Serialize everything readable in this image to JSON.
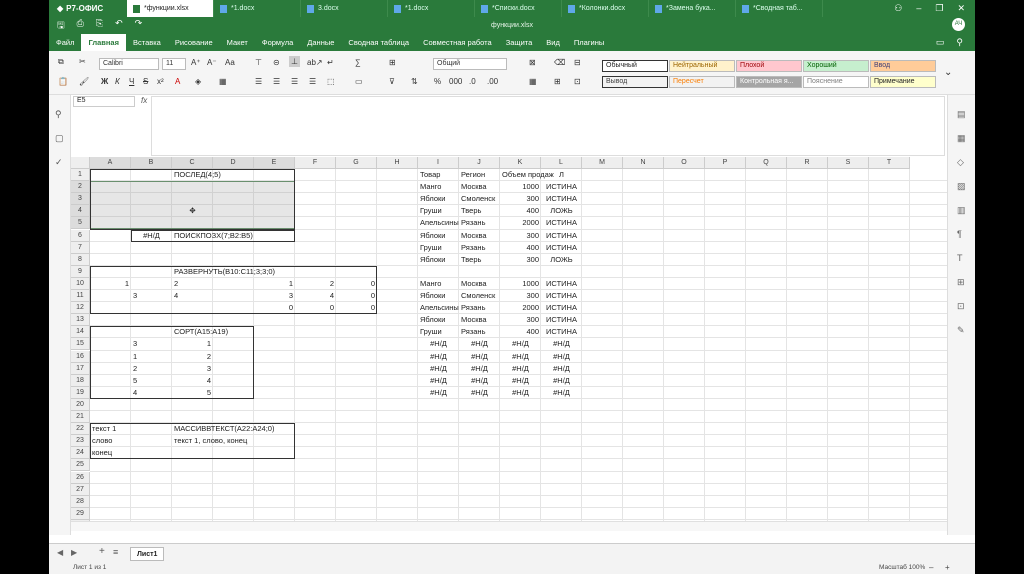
{
  "app": {
    "brand": "Р7-ОФИС",
    "filename": "функции.xlsx"
  },
  "doc_tabs": [
    {
      "label": "*функции.xlsx",
      "active": true
    },
    {
      "label": "*1.docx"
    },
    {
      "label": "3.docx"
    },
    {
      "label": "*1.docx"
    },
    {
      "label": "*Списки.docx"
    },
    {
      "label": "*Колонки.docx"
    },
    {
      "label": "*Замена бука..."
    },
    {
      "label": "*Сводная таб..."
    }
  ],
  "menu": [
    "Файл",
    "Главная",
    "Вставка",
    "Рисование",
    "Макет",
    "Формула",
    "Данные",
    "Сводная таблица",
    "Совместная работа",
    "Защита",
    "Вид",
    "Плагины"
  ],
  "active_menu": "Главная",
  "toolbar": {
    "font_name": "Calibri",
    "font_size": "11",
    "number_format": "Общий",
    "styles": [
      {
        "label": "Обычный",
        "bg": "#ffffff",
        "color": "#222222"
      },
      {
        "label": "Нейтральный",
        "bg": "#fff2cc",
        "color": "#9c6500"
      },
      {
        "label": "Плохой",
        "bg": "#ffc7ce",
        "color": "#9c0006"
      },
      {
        "label": "Хороший",
        "bg": "#c6efce",
        "color": "#006100"
      },
      {
        "label": "Ввод",
        "bg": "#ffcc99",
        "color": "#3f3f76"
      },
      {
        "label": "Вывод",
        "bg": "#f2f2f2",
        "color": "#3f3f3f"
      },
      {
        "label": "Пересчет",
        "bg": "#f2f2f2",
        "color": "#fa7d00"
      },
      {
        "label": "Контрольная я...",
        "bg": "#a5a5a5",
        "color": "#ffffff"
      },
      {
        "label": "Пояснение",
        "bg": "#ffffff",
        "color": "#7f7f7f"
      },
      {
        "label": "Примечание",
        "bg": "#ffffcc",
        "color": "#222222"
      }
    ]
  },
  "namebox": "E5",
  "fx_label": "fx",
  "columns": [
    "A",
    "B",
    "C",
    "D",
    "E",
    "F",
    "G",
    "H",
    "I",
    "J",
    "K",
    "L",
    "M",
    "N",
    "O",
    "P",
    "Q",
    "R",
    "S",
    "T"
  ],
  "rows": [
    "1",
    "2",
    "3",
    "4",
    "5",
    "6",
    "7",
    "8",
    "9",
    "10",
    "11",
    "12",
    "13",
    "14",
    "15",
    "16",
    "17",
    "18",
    "19",
    "20",
    "21",
    "22",
    "23",
    "24",
    "25",
    "26",
    "27",
    "28",
    "29",
    "30"
  ],
  "cells": [
    {
      "ref": "C1",
      "v": "ПОСЛЕД(4;5)"
    },
    {
      "ref": "B6",
      "v": "#Н/Д",
      "align": "c"
    },
    {
      "ref": "C6",
      "v": "ПОИСКПОЗX(7;B2:B5)"
    },
    {
      "ref": "C9",
      "v": "РАЗВЕРНУТЬ(B10:C11;3;3;0)"
    },
    {
      "ref": "A10",
      "v": "1",
      "align": "r"
    },
    {
      "ref": "C10",
      "v": "2"
    },
    {
      "ref": "E10",
      "v": "1",
      "align": "r"
    },
    {
      "ref": "F10",
      "v": "2",
      "align": "r"
    },
    {
      "ref": "G10",
      "v": "0",
      "align": "r"
    },
    {
      "ref": "B11",
      "v": "3"
    },
    {
      "ref": "C11",
      "v": "4"
    },
    {
      "ref": "E11",
      "v": "3",
      "align": "r"
    },
    {
      "ref": "F11",
      "v": "4",
      "align": "r"
    },
    {
      "ref": "G11",
      "v": "0",
      "align": "r"
    },
    {
      "ref": "E12",
      "v": "0",
      "align": "r"
    },
    {
      "ref": "F12",
      "v": "0",
      "align": "r"
    },
    {
      "ref": "G12",
      "v": "0",
      "align": "r"
    },
    {
      "ref": "C14",
      "v": "СОРТ(A15:A19)"
    },
    {
      "ref": "B15",
      "v": "3",
      "align": "l"
    },
    {
      "ref": "C15",
      "v": "1",
      "align": "r"
    },
    {
      "ref": "B16",
      "v": "1",
      "align": "l"
    },
    {
      "ref": "C16",
      "v": "2",
      "align": "r"
    },
    {
      "ref": "B17",
      "v": "2",
      "align": "l"
    },
    {
      "ref": "C17",
      "v": "3",
      "align": "r"
    },
    {
      "ref": "B18",
      "v": "5",
      "align": "l"
    },
    {
      "ref": "C18",
      "v": "4",
      "align": "r"
    },
    {
      "ref": "B19",
      "v": "4",
      "align": "l"
    },
    {
      "ref": "C19",
      "v": "5",
      "align": "r"
    },
    {
      "ref": "A22",
      "v": "текст 1"
    },
    {
      "ref": "C22",
      "v": "МАССИВВТЕКСТ(A22:A24;0)"
    },
    {
      "ref": "A23",
      "v": "слово"
    },
    {
      "ref": "C23",
      "v": "текст 1, слово, конец"
    },
    {
      "ref": "A24",
      "v": "конец"
    },
    {
      "ref": "I1",
      "v": "Товар"
    },
    {
      "ref": "J1",
      "v": "Регион"
    },
    {
      "ref": "K1",
      "v": "Объем продаж"
    },
    {
      "ref": "L1",
      "v": "Л",
      "align": "c"
    },
    {
      "ref": "I2",
      "v": "Манго"
    },
    {
      "ref": "J2",
      "v": "Москва"
    },
    {
      "ref": "K2",
      "v": "1000",
      "align": "r"
    },
    {
      "ref": "L2",
      "v": "ИСТИНА",
      "align": "c"
    },
    {
      "ref": "I3",
      "v": "Яблоки"
    },
    {
      "ref": "J3",
      "v": "Смоленск"
    },
    {
      "ref": "K3",
      "v": "300",
      "align": "r"
    },
    {
      "ref": "L3",
      "v": "ИСТИНА",
      "align": "c"
    },
    {
      "ref": "I4",
      "v": "Груши"
    },
    {
      "ref": "J4",
      "v": "Тверь"
    },
    {
      "ref": "K4",
      "v": "400",
      "align": "r"
    },
    {
      "ref": "L4",
      "v": "ЛОЖЬ",
      "align": "c"
    },
    {
      "ref": "I5",
      "v": "Апельсины"
    },
    {
      "ref": "J5",
      "v": "Рязань"
    },
    {
      "ref": "K5",
      "v": "2000",
      "align": "r"
    },
    {
      "ref": "L5",
      "v": "ИСТИНА",
      "align": "c"
    },
    {
      "ref": "I6",
      "v": "Яблоки"
    },
    {
      "ref": "J6",
      "v": "Москва"
    },
    {
      "ref": "K6",
      "v": "300",
      "align": "r"
    },
    {
      "ref": "L6",
      "v": "ИСТИНА",
      "align": "c"
    },
    {
      "ref": "I7",
      "v": "Груши"
    },
    {
      "ref": "J7",
      "v": "Рязань"
    },
    {
      "ref": "K7",
      "v": "400",
      "align": "r"
    },
    {
      "ref": "L7",
      "v": "ИСТИНА",
      "align": "c"
    },
    {
      "ref": "I8",
      "v": "Яблоки"
    },
    {
      "ref": "J8",
      "v": "Тверь"
    },
    {
      "ref": "K8",
      "v": "300",
      "align": "r"
    },
    {
      "ref": "L8",
      "v": "ЛОЖЬ",
      "align": "c"
    },
    {
      "ref": "I10",
      "v": "Манго"
    },
    {
      "ref": "J10",
      "v": "Москва"
    },
    {
      "ref": "K10",
      "v": "1000",
      "align": "r"
    },
    {
      "ref": "L10",
      "v": "ИСТИНА",
      "align": "c"
    },
    {
      "ref": "I11",
      "v": "Яблоки"
    },
    {
      "ref": "J11",
      "v": "Смоленск"
    },
    {
      "ref": "K11",
      "v": "300",
      "align": "r"
    },
    {
      "ref": "L11",
      "v": "ИСТИНА",
      "align": "c"
    },
    {
      "ref": "I12",
      "v": "Апельсины"
    },
    {
      "ref": "J12",
      "v": "Рязань"
    },
    {
      "ref": "K12",
      "v": "2000",
      "align": "r"
    },
    {
      "ref": "L12",
      "v": "ИСТИНА",
      "align": "c"
    },
    {
      "ref": "I13",
      "v": "Яблоки"
    },
    {
      "ref": "J13",
      "v": "Москва"
    },
    {
      "ref": "K13",
      "v": "300",
      "align": "r"
    },
    {
      "ref": "L13",
      "v": "ИСТИНА",
      "align": "c"
    },
    {
      "ref": "I14",
      "v": "Груши"
    },
    {
      "ref": "J14",
      "v": "Рязань"
    },
    {
      "ref": "K14",
      "v": "400",
      "align": "r"
    },
    {
      "ref": "L14",
      "v": "ИСТИНА",
      "align": "c"
    },
    {
      "ref": "I15",
      "v": "#Н/Д",
      "align": "c"
    },
    {
      "ref": "J15",
      "v": "#Н/Д",
      "align": "c"
    },
    {
      "ref": "K15",
      "v": "#Н/Д",
      "align": "c"
    },
    {
      "ref": "L15",
      "v": "#Н/Д",
      "align": "c"
    },
    {
      "ref": "I16",
      "v": "#Н/Д",
      "align": "c"
    },
    {
      "ref": "J16",
      "v": "#Н/Д",
      "align": "c"
    },
    {
      "ref": "K16",
      "v": "#Н/Д",
      "align": "c"
    },
    {
      "ref": "L16",
      "v": "#Н/Д",
      "align": "c"
    },
    {
      "ref": "I17",
      "v": "#Н/Д",
      "align": "c"
    },
    {
      "ref": "J17",
      "v": "#Н/Д",
      "align": "c"
    },
    {
      "ref": "K17",
      "v": "#Н/Д",
      "align": "c"
    },
    {
      "ref": "L17",
      "v": "#Н/Д",
      "align": "c"
    },
    {
      "ref": "I18",
      "v": "#Н/Д",
      "align": "c"
    },
    {
      "ref": "J18",
      "v": "#Н/Д",
      "align": "c"
    },
    {
      "ref": "K18",
      "v": "#Н/Д",
      "align": "c"
    },
    {
      "ref": "L18",
      "v": "#Н/Д",
      "align": "c"
    },
    {
      "ref": "I19",
      "v": "#Н/Д",
      "align": "c"
    },
    {
      "ref": "J19",
      "v": "#Н/Д",
      "align": "c"
    },
    {
      "ref": "K19",
      "v": "#Н/Д",
      "align": "c"
    },
    {
      "ref": "L19",
      "v": "#Н/Д",
      "align": "c"
    }
  ],
  "sheet_tab": "Лист1",
  "status": {
    "left": "Лист 1 из 1",
    "zoom": "Масштаб 100%"
  }
}
